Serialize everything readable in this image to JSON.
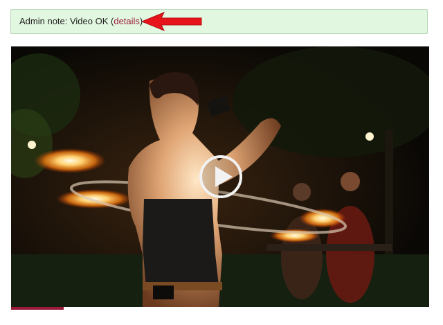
{
  "admin_note": {
    "prefix": "Admin note: Video OK (",
    "link_label": "details",
    "suffix": ")"
  },
  "colors": {
    "note_background": "#e2f7e0",
    "link": "#9b1b3a",
    "arrow": "#e8141c",
    "progress": "#9b1b3a"
  },
  "video": {
    "content": "fire performer with burning hoop at night",
    "play_icon": "play-icon",
    "progress_fraction": 0.125
  }
}
